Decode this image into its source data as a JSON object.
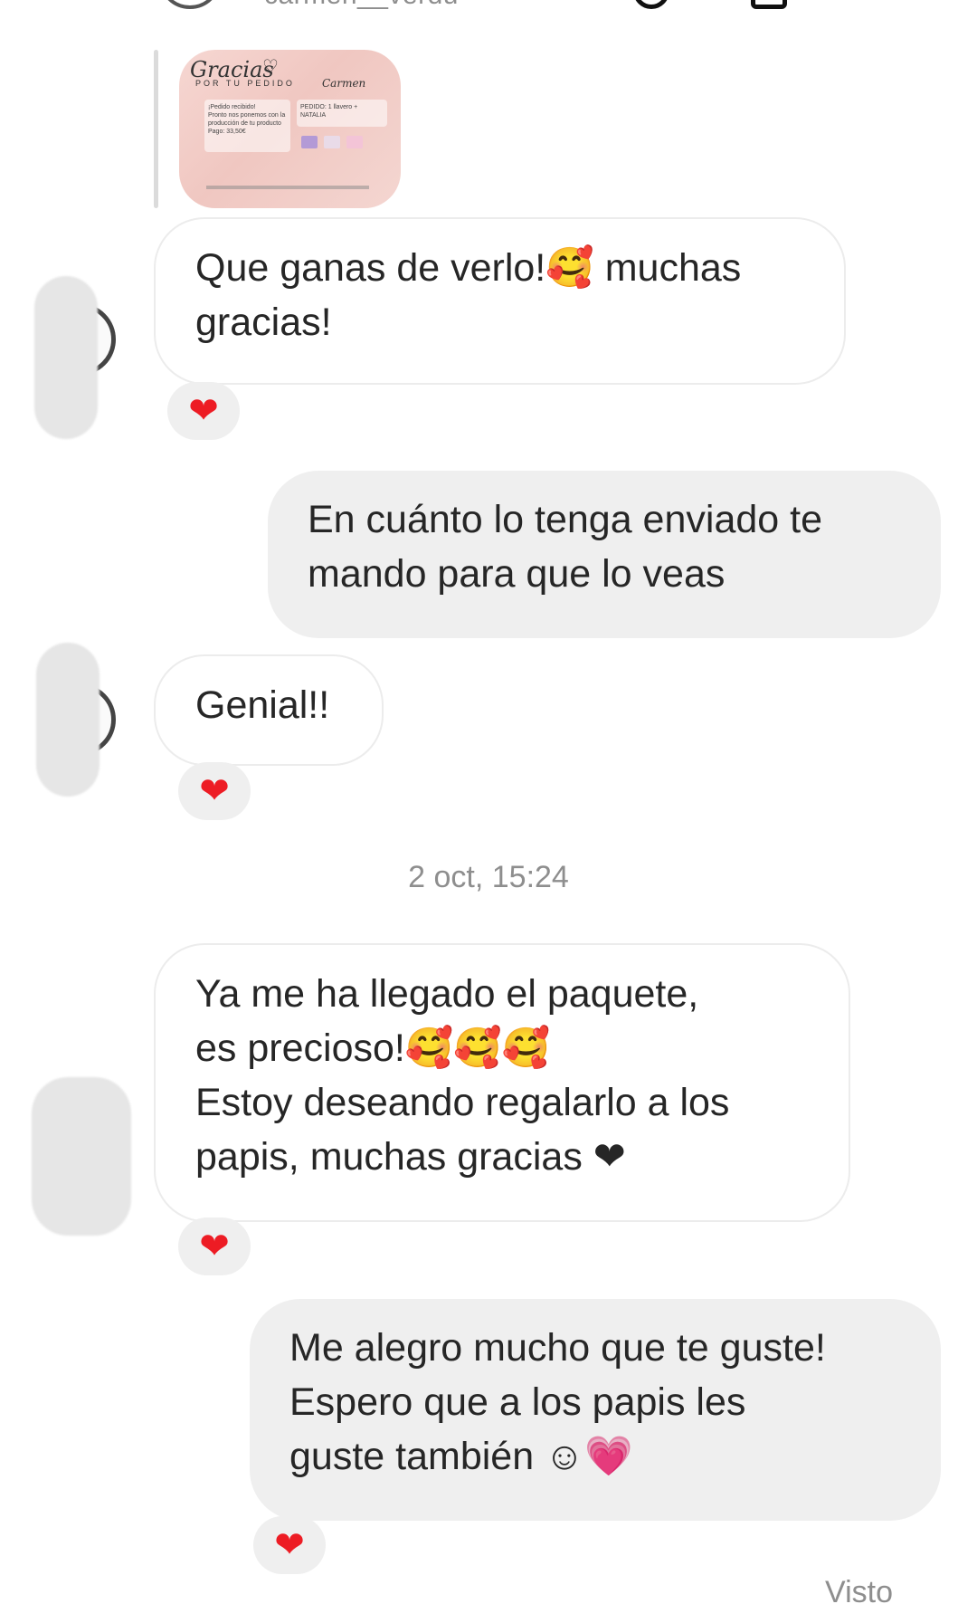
{
  "header": {
    "username": "carmen__verdu"
  },
  "reply_preview": {
    "card_title": "Gracias",
    "card_subtitle": "POR TU PEDIDO",
    "card_name": "Carmen",
    "card_lines": [
      "¡Pedido recibido!",
      "Pronto nos ponemos con la producción de tu producto",
      "Pago: 33,50€"
    ],
    "card_order": "PEDIDO: 1 llavero + NATALIA"
  },
  "messages": [
    {
      "direction": "incoming",
      "lines": [
        "Que ganas de verlo!🥰 muchas",
        "gracias!"
      ],
      "reaction": "❤"
    },
    {
      "direction": "outgoing",
      "lines": [
        "En cuánto lo tenga enviado te",
        "mando para que lo veas"
      ]
    },
    {
      "direction": "incoming",
      "lines": [
        "Genial!!"
      ],
      "reaction": "❤"
    },
    {
      "direction": "incoming",
      "lines": [
        "Ya me ha llegado el paquete,",
        "es precioso!🥰🥰🥰",
        "Estoy deseando regalarlo a los",
        "papis, muchas gracias ❤"
      ],
      "reaction": "❤"
    },
    {
      "direction": "outgoing",
      "lines": [
        "Me alegro mucho que te guste!",
        "Espero que a los papis les",
        "guste también  ☺💗"
      ],
      "reaction": "❤"
    }
  ],
  "timestamp": "2 oct, 15:24",
  "seen_label": "Visto",
  "colors": {
    "reaction_heart": "#ed1c24",
    "outgoing_bubble": "#efefef",
    "meta_text": "#8e8e8e"
  }
}
